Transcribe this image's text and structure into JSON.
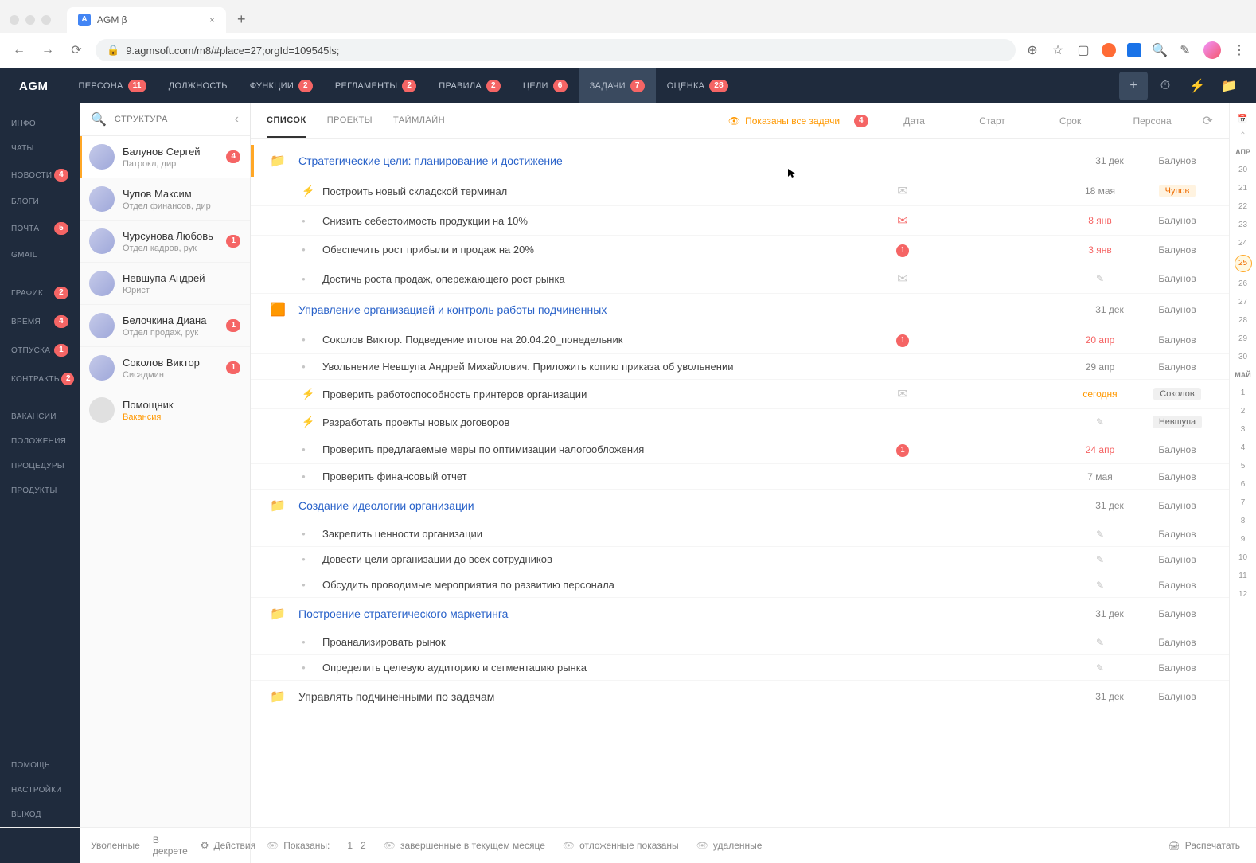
{
  "browser": {
    "tab_title": "AGM β",
    "url": "9.agmsoft.com/m8/#place=27;orgId=109545ls;",
    "favicon_letter": "A"
  },
  "top_nav": {
    "logo": "AGM",
    "items": [
      {
        "label": "ПЕРСОНА",
        "badge": "11"
      },
      {
        "label": "ДОЛЖНОСТЬ",
        "badge": null
      },
      {
        "label": "ФУНКЦИИ",
        "badge": "2"
      },
      {
        "label": "РЕГЛАМЕНТЫ",
        "badge": "2"
      },
      {
        "label": "ПРАВИЛА",
        "badge": "2"
      },
      {
        "label": "ЦЕЛИ",
        "badge": "6"
      },
      {
        "label": "ЗАДАЧИ",
        "badge": "7",
        "active": true
      },
      {
        "label": "ОЦЕНКА",
        "badge": "28"
      }
    ]
  },
  "left_rail": {
    "items": [
      {
        "label": "ИНФО"
      },
      {
        "label": "ЧАТЫ"
      },
      {
        "label": "НОВОСТИ",
        "badge": "4"
      },
      {
        "label": "БЛОГИ"
      },
      {
        "label": "ПОЧТА",
        "badge": "5"
      },
      {
        "label": "GMAIL"
      },
      {
        "label": "ГРАФИК",
        "badge": "2"
      },
      {
        "label": "ВРЕМЯ",
        "badge": "4"
      },
      {
        "label": "ОТПУСКА",
        "badge": "1"
      },
      {
        "label": "КОНТРАКТЫ",
        "badge": "2"
      },
      {
        "label": "ВАКАНСИИ"
      },
      {
        "label": "ПОЛОЖЕНИЯ"
      },
      {
        "label": "ПРОЦЕДУРЫ"
      },
      {
        "label": "ПРОДУКТЫ"
      }
    ],
    "bottom": [
      {
        "label": "ПОМОЩЬ"
      },
      {
        "label": "НАСТРОЙКИ"
      },
      {
        "label": "ВЫХОД"
      }
    ]
  },
  "people_panel": {
    "title": "СТРУКТУРА",
    "people": [
      {
        "name": "Балунов Сергей",
        "role": "Патрокл, дир",
        "badge": "4",
        "selected": true
      },
      {
        "name": "Чупов Максим",
        "role": "Отдел финансов, дир"
      },
      {
        "name": "Чурсунова Любовь",
        "role": "Отдел кадров, рук",
        "badge": "1"
      },
      {
        "name": "Невшупа Андрей",
        "role": "Юрист"
      },
      {
        "name": "Белочкина Диана",
        "role": "Отдел продаж, рук",
        "badge": "1"
      },
      {
        "name": "Соколов Виктор",
        "role": "Сисадмин",
        "badge": "1"
      },
      {
        "name": "Помощник",
        "role": "Вакансия",
        "vacancy": true
      }
    ]
  },
  "main_tabs": {
    "tabs": [
      {
        "label": "СПИСОК",
        "active": true
      },
      {
        "label": "ПРОЕКТЫ"
      },
      {
        "label": "ТАЙМЛАЙН"
      }
    ],
    "shown_label": "Показаны все задачи",
    "shown_badge": "4",
    "cols": [
      "Дата",
      "Старт",
      "Срок",
      "Персона"
    ]
  },
  "task_groups": [
    {
      "title": "Стратегические цели: планирование и достижение",
      "due": "31 дек",
      "person": "Балунов",
      "tasks": [
        {
          "bolt": true,
          "title": "Построить новый складской терминал",
          "icon": "mail",
          "due": "18 мая",
          "person": "Чупов",
          "person_tag": true
        },
        {
          "title": "Снизить себестоимость продукции на 10%",
          "icon": "mail-red",
          "due": "8 янв",
          "due_red": true,
          "person": "Балунов"
        },
        {
          "title": "Обеспечить рост прибыли и продаж на 20%",
          "icon": "badge1",
          "due": "3 янв",
          "due_red": true,
          "person": "Балунов"
        },
        {
          "title": "Достичь роста продаж, опережающего рост рынка",
          "icon": "mail",
          "due_edit": true,
          "person": "Балунов"
        }
      ]
    },
    {
      "title": "Управление организацией и контроль работы подчиненных",
      "folder_yellow": true,
      "due": "31 дек",
      "person": "Балунов",
      "tasks": [
        {
          "title": "Соколов Виктор. Подведение итогов на 20.04.20_понедельник",
          "icon": "badge1",
          "due": "20 апр",
          "due_red": true,
          "person": "Балунов"
        },
        {
          "title": "Увольнение Невшупа Андрей Михайлович. Приложить копию приказа об увольнении",
          "due": "29 апр",
          "person": "Балунов"
        },
        {
          "bolt": true,
          "title": "Проверить работоспособность принтеров организации",
          "icon": "mail",
          "due": "сегодня",
          "due_orange": true,
          "person": "Соколов",
          "person_tag_grey": true
        },
        {
          "bolt": true,
          "title": "Разработать проекты новых договоров",
          "due_edit": true,
          "person": "Невшупа",
          "person_tag_grey": true
        },
        {
          "title": "Проверить предлагаемые меры по оптимизации налогообложения",
          "icon": "badge1",
          "due": "24 апр",
          "due_red": true,
          "person": "Балунов"
        },
        {
          "title": "Проверить финансовый отчет",
          "due": "7 мая",
          "person": "Балунов"
        }
      ]
    },
    {
      "title": "Создание идеологии организации",
      "due": "31 дек",
      "person": "Балунов",
      "tasks": [
        {
          "title": "Закрепить ценности организации",
          "due_edit": true,
          "person": "Балунов"
        },
        {
          "title": "Довести цели организации до всех сотрудников",
          "due_edit": true,
          "person": "Балунов"
        },
        {
          "title": "Обсудить проводимые мероприятия по развитию персонала",
          "due_edit": true,
          "person": "Балунов"
        }
      ]
    },
    {
      "title": "Построение стратегического маркетинга",
      "due": "31 дек",
      "person": "Балунов",
      "tasks": [
        {
          "title": "Проанализировать рынок",
          "due_edit": true,
          "person": "Балунов"
        },
        {
          "title": "Определить целевую аудиторию и сегментацию рынка",
          "due_edit": true,
          "person": "Балунов"
        }
      ]
    },
    {
      "title": "Управлять подчиненными по задачам",
      "title_dark": true,
      "due": "31 дек",
      "person": "Балунов",
      "tasks": []
    }
  ],
  "calendar": {
    "month1": "АПР",
    "days1": [
      "20",
      "21",
      "22",
      "23",
      "24",
      "25",
      "26",
      "27",
      "28",
      "29",
      "30"
    ],
    "today_idx": 5,
    "month2": "МАЙ",
    "days2": [
      "1",
      "2",
      "3",
      "4",
      "5",
      "6",
      "7",
      "8",
      "9",
      "10",
      "11",
      "12"
    ]
  },
  "bottom": {
    "left": {
      "fired": "Уволенные",
      "decree": "В декрете",
      "actions": "Действия"
    },
    "main": {
      "shown": "Показаны:",
      "pages": [
        "1",
        "2"
      ],
      "completed": "завершенные в текущем месяце",
      "deferred": "отложенные показаны",
      "deleted": "удаленные",
      "print": "Распечатать"
    }
  }
}
